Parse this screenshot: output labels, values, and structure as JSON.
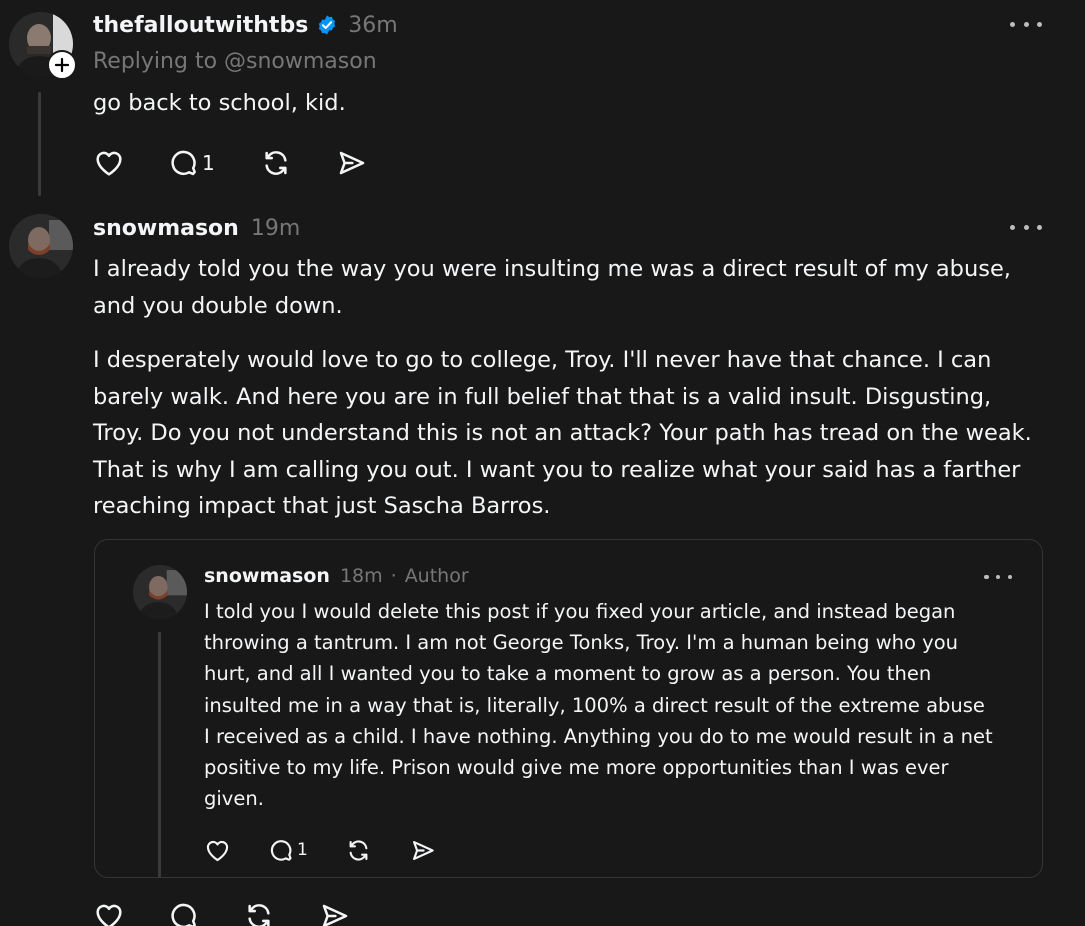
{
  "post1": {
    "username": "thefalloutwithtbs",
    "time": "36m",
    "replying": "Replying to @snowmason",
    "text": "go back to school, kid.",
    "reply_count": "1"
  },
  "post2": {
    "username": "snowmason",
    "time": "19m",
    "paragraph1": "I already told you the way you were insulting me was a direct result of my abuse, and you double down.",
    "paragraph2": "I desperately would love to go to college, Troy. I'll never have that chance. I can barely walk. And here you are in full belief that that is a valid insult. Disgusting, Troy. Do you not understand this is not an attack? Your path has tread on the weak. That is why I am calling you out. I want you to realize what your said has a farther reaching impact that just Sascha Barros."
  },
  "quoted": {
    "username": "snowmason",
    "time": "18m",
    "separator": "·",
    "author_badge": "Author",
    "text": "I told you I would delete this post if you fixed your article, and instead began throwing a tantrum. I am not George Tonks, Troy. I'm a human being who you hurt, and all I wanted you to take a moment to grow as a person. You then insulted me in a way that is, literally, 100% a direct result of the extreme abuse I received as a child. I have nothing. Anything you do to me would result in a net positive to my life. Prison would give me more opportunities than I was ever given.",
    "reply_count": "1"
  },
  "icons": {
    "verified": "verified-badge-icon",
    "like": "heart-icon",
    "reply": "comment-icon",
    "repost": "repost-icon",
    "share": "send-icon",
    "more": "more-dots-icon",
    "follow": "plus-icon"
  },
  "colors": {
    "background": "#181818",
    "text": "#f3f5f7",
    "muted": "#777777",
    "verified": "#0095f6"
  }
}
